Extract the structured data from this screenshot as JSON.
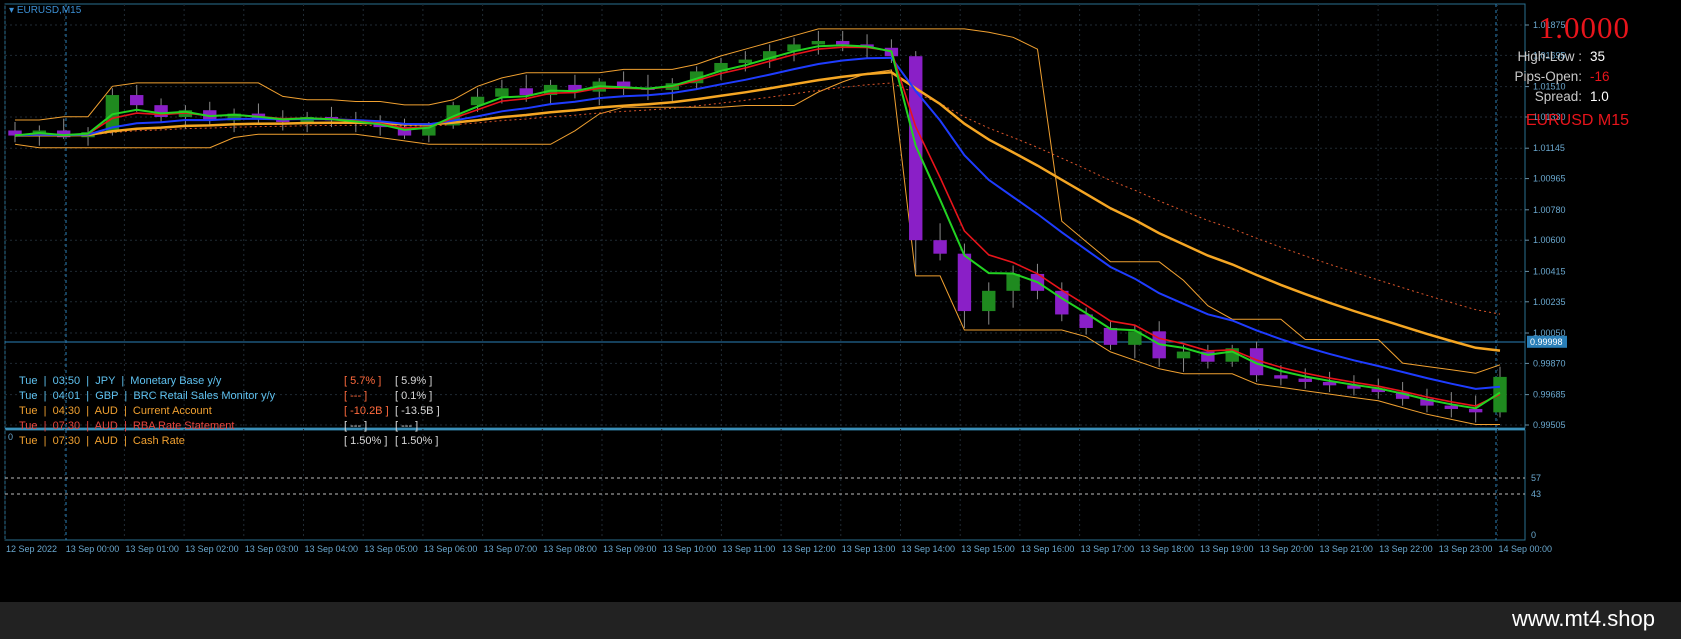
{
  "symbol_label": "EURUSD,M15",
  "info": {
    "price": "1.0000",
    "rows": [
      {
        "label": "High-Low :",
        "value": "35",
        "color": "#ffffff"
      },
      {
        "label": "Pips-Open:",
        "value": "-16",
        "color": "#e8141b"
      },
      {
        "label": "Spread:",
        "value": "1.0",
        "color": "#ffffff"
      }
    ],
    "symbol_tf": "EURUSD M15"
  },
  "news": [
    {
      "text": "Tue  |  03:50  |  JPY  |  Monetary Base y/y",
      "a": "[ 5.7% ]",
      "b": "[ 5.9% ]",
      "color": "#5fc2f0",
      "a_color": "#ff6a3d"
    },
    {
      "text": "Tue  |  04:01  |  GBP  |  BRC Retail Sales Monitor y/y",
      "a": "[ --- ]",
      "b": "[ 0.1% ]",
      "color": "#5fc2f0",
      "a_color": "#ff6a3d"
    },
    {
      "text": "Tue  |  04:30  |  AUD  |  Current Account",
      "a": "[ -10.2B ]",
      "b": "[ -13.5B ]",
      "color": "#f0a030",
      "a_color": "#ff6a3d"
    },
    {
      "text": "Tue  |  07:30  |  AUD  |  RBA Rate Statement",
      "a": "[ --- ]",
      "b": "[ --- ]",
      "color": "#e8453d",
      "a_color": "#d8d8d8"
    },
    {
      "text": "Tue  |  07:30  |  AUD  |  Cash Rate",
      "a": "[ 1.50% ]",
      "b": "[ 1.50% ]",
      "color": "#f0a030",
      "a_color": "#d8d8d8"
    }
  ],
  "watermark": "www.mt4.shop",
  "chart_data": {
    "type": "line",
    "title": "EURUSD,M15",
    "price_axis": {
      "ticks": [
        "1.01875",
        "1.01695",
        "1.01510",
        "1.01330",
        "1.01145",
        "1.00965",
        "1.00780",
        "1.00600",
        "1.00415",
        "1.00235",
        "1.00050",
        "0.99870",
        "0.99685",
        "0.99505"
      ],
      "current_price": "0.99998",
      "ylim": [
        0.99505,
        1.01875
      ]
    },
    "time_axis": [
      "12 Sep 2022",
      "13 Sep 00:00",
      "13 Sep 01:00",
      "13 Sep 02:00",
      "13 Sep 03:00",
      "13 Sep 04:00",
      "13 Sep 05:00",
      "13 Sep 06:00",
      "13 Sep 07:00",
      "13 Sep 08:00",
      "13 Sep 09:00",
      "13 Sep 10:00",
      "13 Sep 11:00",
      "13 Sep 12:00",
      "13 Sep 13:00",
      "13 Sep 14:00",
      "13 Sep 15:00",
      "13 Sep 16:00",
      "13 Sep 17:00",
      "13 Sep 18:00",
      "13 Sep 19:00",
      "13 Sep 20:00",
      "13 Sep 21:00",
      "13 Sep 22:00",
      "13 Sep 23:00",
      "14 Sep 00:00"
    ],
    "indicator_axis": {
      "ticks": [
        "0",
        "57",
        "43",
        "0"
      ]
    },
    "candles": [
      [
        1.0125,
        1.013,
        1.0118,
        1.0122
      ],
      [
        1.0122,
        1.0128,
        1.0116,
        1.0125
      ],
      [
        1.0125,
        1.0132,
        1.012,
        1.0121
      ],
      [
        1.0121,
        1.0127,
        1.0116,
        1.0124
      ],
      [
        1.0124,
        1.015,
        1.0122,
        1.0146
      ],
      [
        1.0146,
        1.0152,
        1.0136,
        1.014
      ],
      [
        1.014,
        1.0144,
        1.013,
        1.0133
      ],
      [
        1.0133,
        1.014,
        1.0126,
        1.0137
      ],
      [
        1.0137,
        1.0142,
        1.0128,
        1.0131
      ],
      [
        1.0131,
        1.0138,
        1.0124,
        1.0135
      ],
      [
        1.0135,
        1.0141,
        1.0129,
        1.0132
      ],
      [
        1.0132,
        1.0137,
        1.0125,
        1.013
      ],
      [
        1.013,
        1.0136,
        1.0124,
        1.0133
      ],
      [
        1.0133,
        1.0139,
        1.0127,
        1.0131
      ],
      [
        1.0131,
        1.0136,
        1.0124,
        1.0129
      ],
      [
        1.0129,
        1.0134,
        1.0122,
        1.0127
      ],
      [
        1.0127,
        1.0132,
        1.012,
        1.0122
      ],
      [
        1.0122,
        1.013,
        1.0118,
        1.0128
      ],
      [
        1.0128,
        1.0142,
        1.0126,
        1.014
      ],
      [
        1.014,
        1.015,
        1.0136,
        1.0145
      ],
      [
        1.0145,
        1.0155,
        1.0141,
        1.015
      ],
      [
        1.015,
        1.0158,
        1.0142,
        1.0146
      ],
      [
        1.0146,
        1.0155,
        1.014,
        1.0152
      ],
      [
        1.0152,
        1.0158,
        1.0144,
        1.0148
      ],
      [
        1.0148,
        1.0156,
        1.014,
        1.0154
      ],
      [
        1.0154,
        1.016,
        1.0146,
        1.015
      ],
      [
        1.015,
        1.0158,
        1.0143,
        1.0149
      ],
      [
        1.0149,
        1.0156,
        1.0141,
        1.0153
      ],
      [
        1.0153,
        1.0163,
        1.0149,
        1.016
      ],
      [
        1.016,
        1.0168,
        1.0155,
        1.0165
      ],
      [
        1.0165,
        1.0172,
        1.016,
        1.0167
      ],
      [
        1.0167,
        1.0176,
        1.0162,
        1.0172
      ],
      [
        1.0172,
        1.018,
        1.0166,
        1.0176
      ],
      [
        1.0176,
        1.0184,
        1.017,
        1.0178
      ],
      [
        1.0178,
        1.0184,
        1.0172,
        1.0176
      ],
      [
        1.0176,
        1.0182,
        1.0168,
        1.0174
      ],
      [
        1.0174,
        1.0179,
        1.0165,
        1.0169
      ],
      [
        1.0169,
        1.0172,
        1.004,
        1.006
      ],
      [
        1.006,
        1.007,
        1.0048,
        1.0052
      ],
      [
        1.0052,
        1.0058,
        1.0008,
        1.0018
      ],
      [
        1.0018,
        1.0035,
        1.001,
        1.003
      ],
      [
        1.003,
        1.0045,
        1.002,
        1.004
      ],
      [
        1.004,
        1.0046,
        1.0025,
        1.003
      ],
      [
        1.003,
        1.0035,
        1.0012,
        1.0016
      ],
      [
        1.0016,
        1.002,
        1.0004,
        1.0008
      ],
      [
        1.0008,
        1.0012,
        0.9995,
        0.9998
      ],
      [
        0.9998,
        1.001,
        0.999,
        1.0006
      ],
      [
        1.0006,
        1.0012,
        0.9985,
        0.999
      ],
      [
        0.999,
        0.9998,
        0.9982,
        0.9994
      ],
      [
        0.9994,
        0.9998,
        0.9984,
        0.9988
      ],
      [
        0.9988,
        0.9998,
        0.9985,
        0.9996
      ],
      [
        0.9996,
        1.0,
        0.9976,
        0.998
      ],
      [
        0.998,
        0.9986,
        0.9974,
        0.9978
      ],
      [
        0.9978,
        0.9984,
        0.9972,
        0.9976
      ],
      [
        0.9976,
        0.9982,
        0.997,
        0.9974
      ],
      [
        0.9974,
        0.998,
        0.9968,
        0.9972
      ],
      [
        0.9972,
        0.9978,
        0.9966,
        0.997
      ],
      [
        0.997,
        0.9976,
        0.9962,
        0.9966
      ],
      [
        0.9966,
        0.9972,
        0.9958,
        0.9962
      ],
      [
        0.9962,
        0.997,
        0.9955,
        0.996
      ],
      [
        0.996,
        0.9968,
        0.9952,
        0.9958
      ],
      [
        0.9958,
        0.9985,
        0.9955,
        0.9979
      ]
    ]
  }
}
